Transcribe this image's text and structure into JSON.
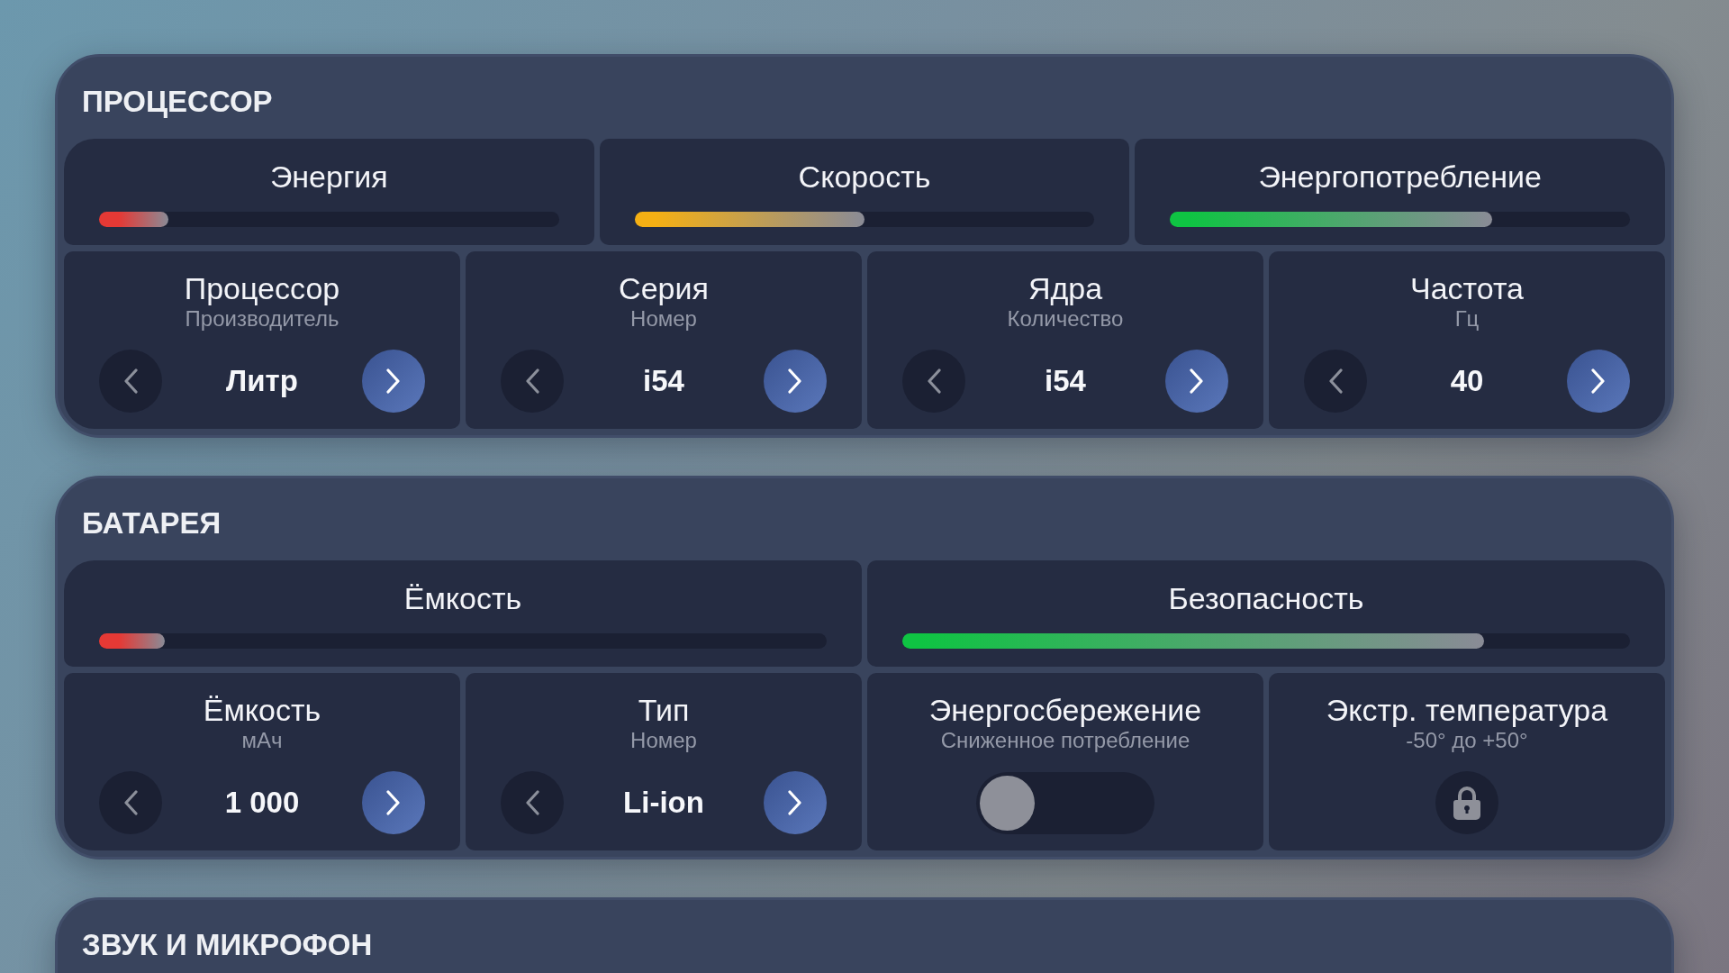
{
  "sections": [
    {
      "title": "ПРОЦЕССОР",
      "meters": [
        {
          "label": "Энергия",
          "level": 0.15,
          "color": "#e53935"
        },
        {
          "label": "Скорость",
          "level": 0.5,
          "color": "#f5b014"
        },
        {
          "label": "Энергопотребление",
          "level": 0.7,
          "color": "#0fc443"
        }
      ],
      "controls": [
        {
          "kind": "stepper",
          "title": "Процессор",
          "subtitle": "Производитель",
          "value": "Литр"
        },
        {
          "kind": "stepper",
          "title": "Серия",
          "subtitle": "Номер",
          "value": "i54"
        },
        {
          "kind": "stepper",
          "title": "Ядра",
          "subtitle": "Количество",
          "value": "i54"
        },
        {
          "kind": "stepper",
          "title": "Частота",
          "subtitle": "Гц",
          "value": "40"
        }
      ]
    },
    {
      "title": "БАТАРЕЯ",
      "meters": [
        {
          "label": "Ёмкость",
          "level": 0.09,
          "color": "#e53935"
        },
        {
          "label": "Безопасность",
          "level": 0.8,
          "color": "#0fc443"
        }
      ],
      "controls": [
        {
          "kind": "stepper",
          "title": "Ёмкость",
          "subtitle": "мАч",
          "value": "1 000"
        },
        {
          "kind": "stepper",
          "title": "Тип",
          "subtitle": "Номер",
          "value": "Li-ion"
        },
        {
          "kind": "toggle",
          "title": "Энергосбережение",
          "subtitle": "Сниженное потребление",
          "on": false
        },
        {
          "kind": "lock",
          "title": "Экстр. температура",
          "subtitle": "-50° до +50°"
        }
      ]
    },
    {
      "title": "ЗВУК И МИКРОФОН"
    }
  ]
}
